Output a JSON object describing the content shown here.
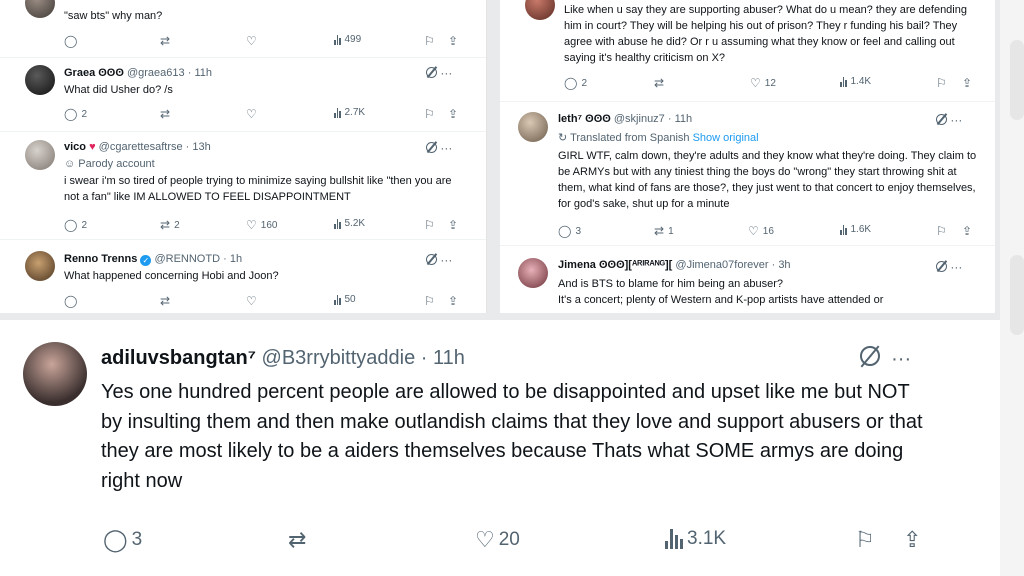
{
  "left": {
    "top_partial": {
      "body": "\"saw bts\" why man?",
      "views": "499"
    },
    "tweets": [
      {
        "name": "Graea ʘʘʘ",
        "handle": "@graea613",
        "time": "11h",
        "body": "What did Usher do? /s",
        "replies": "2",
        "retweets": "",
        "likes": "",
        "views": "2.7K"
      },
      {
        "name": "vico",
        "handle": "@cgarettesaftrse",
        "time": "13h",
        "sub": "Parody account",
        "body": "i swear i'm so tired of people trying to minimize saying bullshit like \"then you are not a fan\" like IM ALLOWED TO FEEL DISAPPOINTMENT",
        "replies": "2",
        "retweets": "2",
        "likes": "160",
        "views": "5.2K"
      },
      {
        "name": "Renno Trenns",
        "handle": "@RENNOTD",
        "time": "1h",
        "body": "What happened concerning Hobi and Joon?",
        "replies": "",
        "retweets": "",
        "likes": "",
        "views": "50"
      }
    ]
  },
  "right": {
    "top_partial": {
      "body": "Like when u say they are supporting abuser? What do u mean? they are defending him in court? They will be helping his out of prison? They r funding his bail? They agree with abuse he did? Or r u assuming what they know or feel and calling out saying it's healthy criticism on X?",
      "replies": "2",
      "retweets": "",
      "likes": "12",
      "views": "1.4K"
    },
    "tweets": [
      {
        "name": "leth⁷ ʘʘʘ",
        "handle": "@skjinuz7",
        "time": "11h",
        "sub": "Translated from Spanish",
        "sub_link": "Show original",
        "body": "GIRL WTF, calm down, they're adults and they know what they're doing. They claim to be ARMYs but with any tiniest thing the boys do \"wrong\" they start throwing shit at them, what kind of fans are those?, they just went to that concert to enjoy themselves, for god's sake, shut up for a minute",
        "replies": "3",
        "retweets": "1",
        "likes": "16",
        "views": "1.6K"
      },
      {
        "name": "Jimena ʘʘʘ][ᴬᴿᴵᴿᴬᴺᴳ][",
        "handle": "@Jimena07forever",
        "time": "3h",
        "body": "And is BTS to blame for him being an abuser?\nIt's a concert; plenty of Western and K-pop artists have attended or"
      }
    ]
  },
  "main": {
    "name": "adiluvsbangtan⁷",
    "handle": "@B3rrybittyaddie",
    "time": "11h",
    "body": "Yes one hundred percent people are allowed to be disappointed and upset like me  but NOT by insulting them and then make outlandish claims that they love and support abusers or that they are most likely to be a aiders themselves because Thats what SOME armys are doing right now",
    "replies": "3",
    "likes": "20",
    "views": "3.1K"
  },
  "icons": {
    "reply": "reply-icon",
    "retweet": "retweet-icon",
    "like": "heart-icon",
    "views": "views-icon",
    "bookmark": "bookmark-icon",
    "share": "share-icon",
    "grok": "grok-icon",
    "more": "more-icon"
  },
  "separator": "·"
}
